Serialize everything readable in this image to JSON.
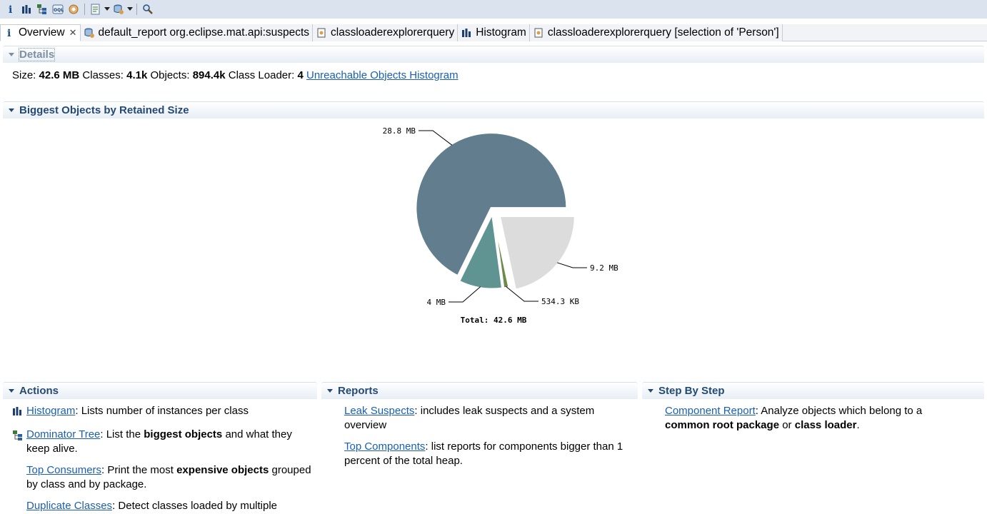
{
  "toolbar": {
    "items": [
      "info-icon",
      "histogram-icon",
      "dominator-tree-icon",
      "oql-icon",
      "heap-dump-overview-icon",
      "run-report-icon",
      "query-browser-icon",
      "search-icon"
    ]
  },
  "tabs": [
    {
      "label": "Overview",
      "icon": "info-icon",
      "active": true
    },
    {
      "label": "default_report  org.eclipse.mat.api:suspects",
      "icon": "report-icon"
    },
    {
      "label": "classloaderexplorerquery",
      "icon": "query-icon"
    },
    {
      "label": "Histogram",
      "icon": "histogram-icon"
    },
    {
      "label": "classloaderexplorerquery [selection of 'Person']",
      "icon": "query-icon"
    }
  ],
  "details": {
    "header": "Details",
    "size_label": "Size:",
    "size_value": "42.6 MB",
    "classes_label": "Classes:",
    "classes_value": "4.1k",
    "objects_label": "Objects:",
    "objects_value": "894.4k",
    "loader_label": "Class Loader:",
    "loader_value": "4",
    "unreachable_link": "Unreachable Objects Histogram"
  },
  "biggest": {
    "header": "Biggest Objects by Retained Size",
    "total": "Total: 42.6 MB"
  },
  "chart_data": {
    "type": "pie",
    "title": "",
    "total_label": "Total: 42.6 MB",
    "slices": [
      {
        "label": "28.8 MB",
        "value": 28.8,
        "color": "#617d8e"
      },
      {
        "label": "4 MB",
        "value": 4.0,
        "color": "#5f9493"
      },
      {
        "label": "534.3 KB",
        "value": 0.52,
        "color": "#6c8a4c"
      },
      {
        "label": "9.2 MB",
        "value": 9.2,
        "color": "#dcdcdc"
      }
    ]
  },
  "actions": {
    "header": "Actions",
    "items": [
      {
        "link": "Histogram",
        "text": ": Lists number of instances per class"
      },
      {
        "link": "Dominator Tree",
        "text1": ": List the ",
        "bold": "biggest objects",
        "text2": " and what they keep alive."
      },
      {
        "link": "Top Consumers",
        "text1": ": Print the most ",
        "bold": "expensive objects",
        "text2": " grouped by class and by package."
      },
      {
        "link": "Duplicate Classes",
        "text": ": Detect classes loaded by multiple"
      }
    ]
  },
  "reports": {
    "header": "Reports",
    "items": [
      {
        "link": "Leak Suspects",
        "text": ": includes leak suspects and a system overview"
      },
      {
        "link": "Top Components",
        "text": ": list reports for components bigger than 1 percent of the total heap."
      }
    ]
  },
  "stepbystep": {
    "header": "Step By Step",
    "link": "Component Report",
    "text1": ": Analyze objects which belong to a ",
    "bold1": "common root package",
    "text2": " or ",
    "bold2": "class loader",
    "text3": "."
  }
}
